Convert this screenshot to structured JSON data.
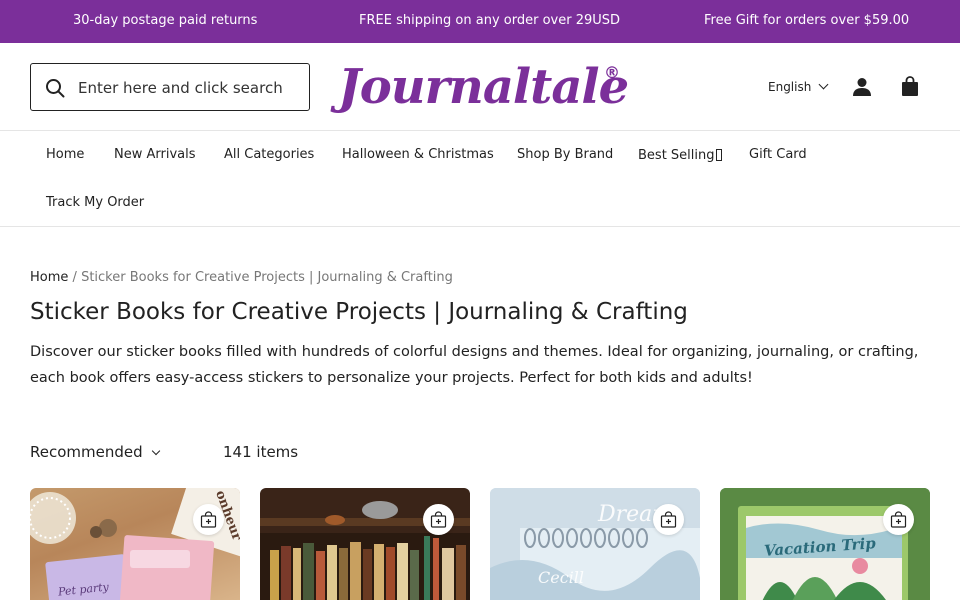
{
  "announcements": [
    "30-day postage paid returns",
    "FREE shipping on any order over 29USD",
    "Free Gift for orders over $59.00"
  ],
  "search": {
    "placeholder": "Enter here and click search"
  },
  "logo": {
    "text": "Journaltale",
    "mark": "®"
  },
  "language": {
    "selected": "English"
  },
  "nav": [
    "Home",
    "New Arrivals",
    "All Categories",
    "Halloween & Christmas",
    "Shop By Brand",
    "Best Selling",
    "Gift Card",
    "Track My Order"
  ],
  "breadcrumb": {
    "home": "Home",
    "separator": "/",
    "current": "Sticker Books for Creative Projects | Journaling & Crafting"
  },
  "collection": {
    "title": "Sticker Books for Creative Projects | Journaling & Crafting",
    "description": "Discover our sticker books filled with hundreds of colorful designs and themes. Ideal for organizing, journaling, or crafting, each book offers easy-access stickers to personalize your projects. Perfect for both kids and adults!",
    "sort_label": "Recommended",
    "item_count": "141 items"
  },
  "products": [
    {
      "image_text": [
        "Pet party",
        "onheur"
      ]
    },
    {
      "image_text": []
    },
    {
      "image_text": [
        "Dream",
        "Cecill"
      ]
    },
    {
      "image_text": [
        "Vacation Trip"
      ]
    }
  ],
  "colors": {
    "brand": "#7b2f9a",
    "announce_bg": "#7b2f9a",
    "text": "#222222",
    "muted": "#777777"
  }
}
